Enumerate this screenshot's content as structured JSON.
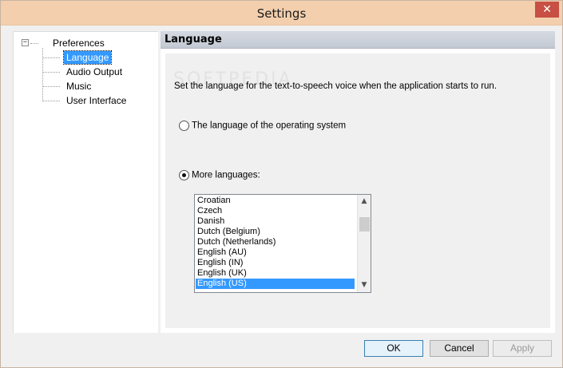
{
  "window": {
    "title": "Settings",
    "close_glyph": "✕"
  },
  "tree": {
    "root": {
      "label": "Preferences",
      "expander": "−"
    },
    "children": [
      {
        "label": "Language",
        "selected": true
      },
      {
        "label": "Audio Output",
        "selected": false
      },
      {
        "label": "Music",
        "selected": false
      },
      {
        "label": "User Interface",
        "selected": false
      }
    ]
  },
  "panel": {
    "header": "Language",
    "watermark": "SOFTPEDIA",
    "description": "Set the language for the text-to-speech voice when the application starts to run.",
    "options": [
      {
        "label": "The language of the operating system",
        "checked": false
      },
      {
        "label": "More languages:",
        "checked": true
      }
    ],
    "languages": [
      "Croatian",
      "Czech",
      "Danish",
      "Dutch (Belgium)",
      "Dutch (Netherlands)",
      "English (AU)",
      "English (IN)",
      "English (UK)",
      "English (US)"
    ],
    "selected_language": "English (US)"
  },
  "buttons": {
    "ok": "OK",
    "cancel": "Cancel",
    "apply": "Apply",
    "apply_enabled": false
  },
  "icons": {
    "scroll_up": "chevron-up-icon",
    "scroll_down": "chevron-down-icon"
  }
}
